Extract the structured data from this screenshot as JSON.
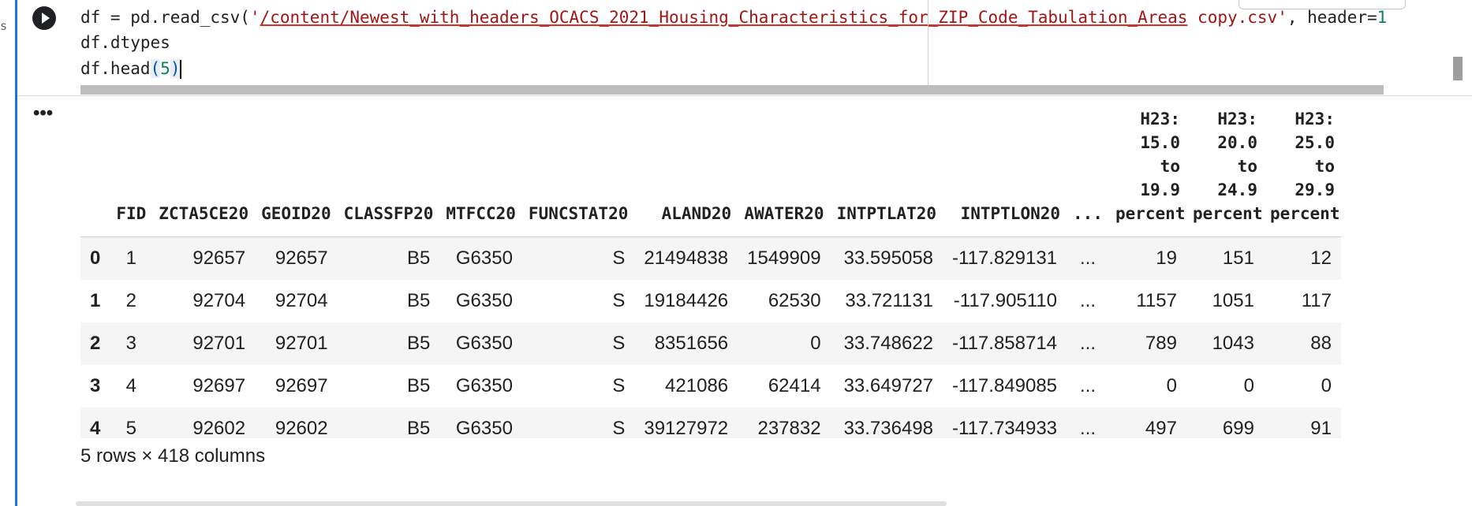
{
  "gutter": {
    "char": "s"
  },
  "code": {
    "line1_pre": "df = pd.read_csv(",
    "line1_quote_open": "'",
    "line1_path": "/content/Newest_with_headers_OCACS_2021_Housing_Characteristics_for_ZIP_Code_Tabulation_Areas",
    "line1_path_tail": " copy.csv'",
    "line1_post": ", header=",
    "line1_num": "1",
    "line2": "df.dtypes",
    "line3_pre": "df.head",
    "line3_paren_open": "(",
    "line3_num": "5",
    "line3_paren_close": ")"
  },
  "output": {
    "more_label": "•••",
    "columns": [
      "",
      "FID",
      "ZCTA5CE20",
      "GEOID20",
      "CLASSFP20",
      "MTFCC20",
      "FUNCSTAT20",
      "ALAND20",
      "AWATER20",
      "INTPTLAT20",
      "INTPTLON20",
      "...",
      "H23: 15.0 to 19.9 percent",
      "H23: 20.0 to 24.9 percent",
      "H23: 25.0 to 29.9 percent"
    ],
    "rows": [
      [
        "0",
        "1",
        "92657",
        "92657",
        "B5",
        "G6350",
        "S",
        "21494838",
        "1549909",
        "33.595058",
        "-117.829131",
        "...",
        "19",
        "151",
        "12"
      ],
      [
        "1",
        "2",
        "92704",
        "92704",
        "B5",
        "G6350",
        "S",
        "19184426",
        "62530",
        "33.721131",
        "-117.905110",
        "...",
        "1157",
        "1051",
        "117"
      ],
      [
        "2",
        "3",
        "92701",
        "92701",
        "B5",
        "G6350",
        "S",
        "8351656",
        "0",
        "33.748622",
        "-117.858714",
        "...",
        "789",
        "1043",
        "88"
      ],
      [
        "3",
        "4",
        "92697",
        "92697",
        "B5",
        "G6350",
        "S",
        "421086",
        "62414",
        "33.649727",
        "-117.849085",
        "...",
        "0",
        "0",
        "0"
      ],
      [
        "4",
        "5",
        "92602",
        "92602",
        "B5",
        "G6350",
        "S",
        "39127972",
        "237832",
        "33.736498",
        "-117.734933",
        "...",
        "497",
        "699",
        "91"
      ]
    ],
    "shape_text": "5 rows × 418 columns"
  }
}
